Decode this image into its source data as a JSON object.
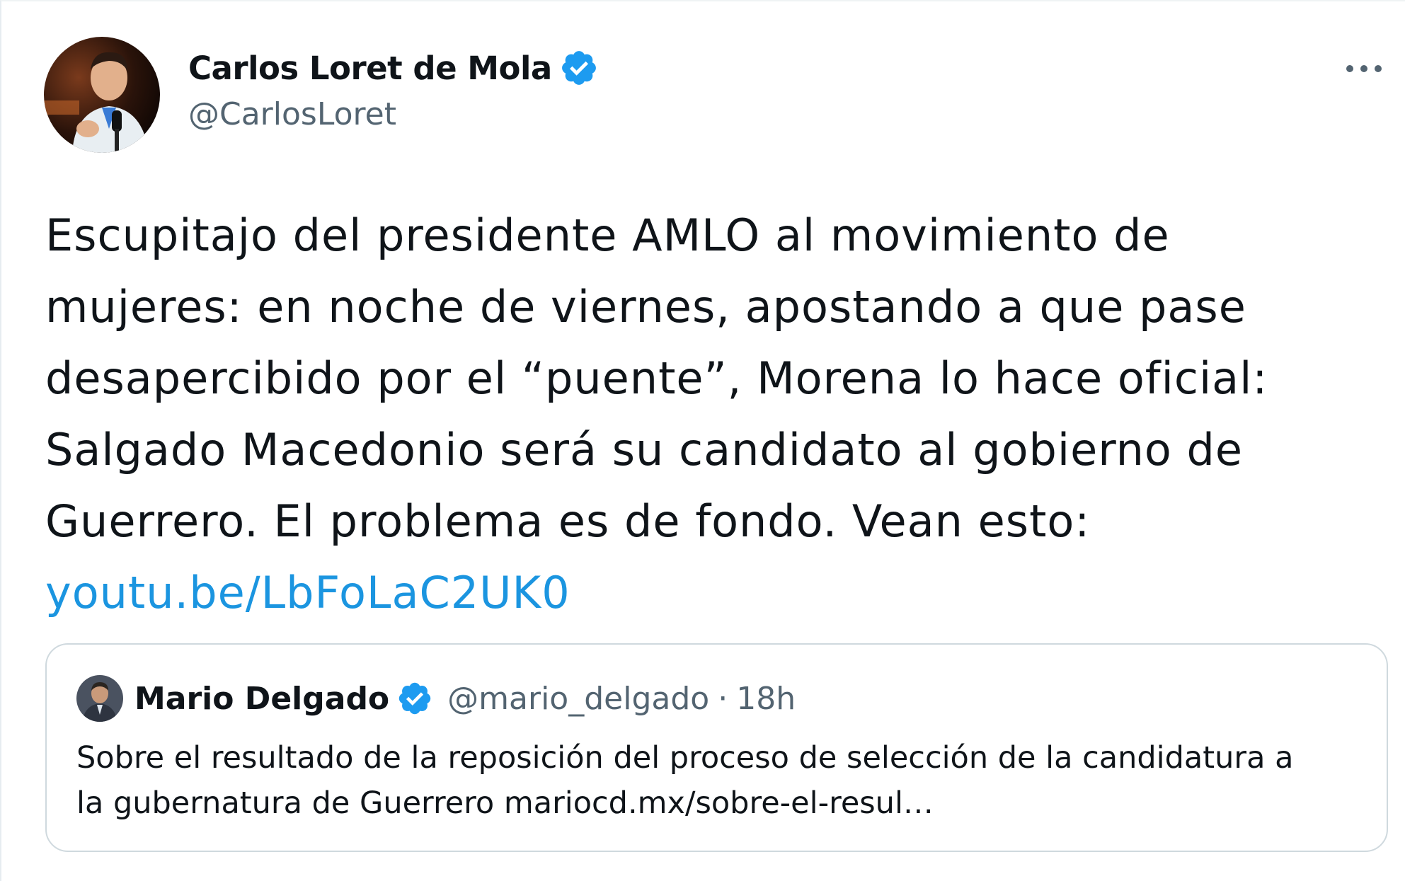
{
  "author": {
    "name": "Carlos Loret de Mola",
    "handle": "@CarlosLoret",
    "verified": true,
    "avatar_icon": "profile-photo-icon"
  },
  "more_icon": "more-options-icon",
  "tweet": {
    "text_lines": [
      "Escupitajo del presidente AMLO al movimiento de",
      "mujeres: en noche de viernes, apostando a que pase",
      "desapercibido por el “puente”, Morena lo hace oficial:",
      "Salgado Macedonio será su candidato al gobierno de",
      "Guerrero. El problema es de fondo. Vean esto:"
    ],
    "link": "youtu.be/LbFoLaC2UK0"
  },
  "quoted_tweet": {
    "name": "Mario Delgado",
    "handle": "@mario_delgado",
    "separator": "·",
    "time": "18h",
    "verified": true,
    "text_lines": [
      "Sobre el resultado de la reposición del proceso de selección de la candidatura a",
      "la gubernatura de Guerrero mariocd.mx/sobre-el-resul…"
    ]
  },
  "colors": {
    "link": "#1b95e0",
    "verified_badge": "#1d9bf0",
    "secondary_text": "#536471",
    "card_border": "#cfd9de"
  }
}
